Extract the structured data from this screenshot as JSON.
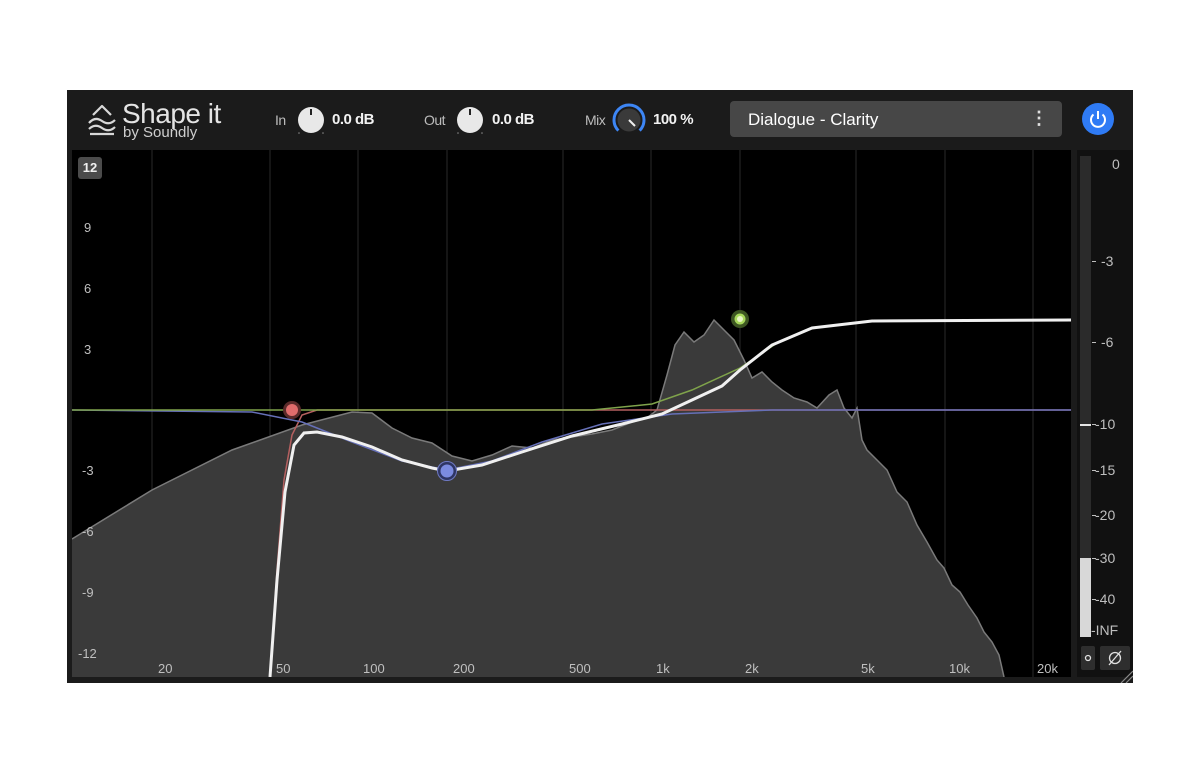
{
  "app": {
    "name": "Shape it",
    "vendor": "by Soundly"
  },
  "controls": {
    "input": {
      "label": "In",
      "value": "0.0 dB"
    },
    "output": {
      "label": "Out",
      "value": "0.0 dB"
    },
    "mix": {
      "label": "Mix",
      "value": "100 %",
      "percent": 100
    }
  },
  "preset": {
    "name": "Dialogue - Clarity",
    "menu_glyph": "⋮"
  },
  "power": {
    "icon": "power-icon",
    "state": "on",
    "color": "#2f7bf5"
  },
  "graph": {
    "range_badge": "12",
    "db_labels": [
      "9",
      "6",
      "3",
      "-3",
      "-6",
      "-9",
      "-12"
    ],
    "freq_labels": [
      "20",
      "50",
      "100",
      "200",
      "500",
      "1k",
      "2k",
      "5k",
      "10k",
      "20k"
    ],
    "bands": [
      {
        "name": "low-cut",
        "color": "#e06c6c",
        "freq_hz": 55,
        "gain_db": 0
      },
      {
        "name": "bell",
        "color": "#7b8be0",
        "freq_hz": 190,
        "gain_db": -3
      },
      {
        "name": "high-shelf",
        "color": "#9fd24a",
        "freq_hz": 1950,
        "gain_db": 4.5
      }
    ]
  },
  "meter": {
    "scale_labels": [
      "0",
      "-3",
      "-6",
      "-10",
      "-15",
      "-20",
      "-30",
      "-40",
      "-INF"
    ],
    "level_db": -30,
    "peak_db": -10,
    "mono_icon": "mono-icon",
    "phase_icon": "phase-invert-icon"
  },
  "colors": {
    "background": "#1b1b1b",
    "graph": "#000000",
    "accent": "#2f7bf5",
    "curve": "#f0f0f0"
  }
}
